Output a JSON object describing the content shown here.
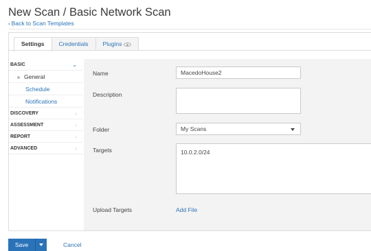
{
  "header": {
    "title": "New Scan / Basic Network Scan",
    "back_chevron": "‹",
    "back_link": "Back to Scan Templates"
  },
  "tabs": [
    {
      "label": "Settings",
      "active": true
    },
    {
      "label": "Credentials",
      "active": false
    },
    {
      "label": "Plugins",
      "active": false,
      "icon": "eye-icon"
    }
  ],
  "sidebar": {
    "basic": {
      "label": "BASIC",
      "expanded": true,
      "arrow": "⌄"
    },
    "basic_items": [
      {
        "label": "General",
        "active": true
      },
      {
        "label": "Schedule",
        "active": false
      },
      {
        "label": "Notifications",
        "active": false
      }
    ],
    "sections": [
      {
        "label": "DISCOVERY",
        "arrow": "›"
      },
      {
        "label": "ASSESSMENT",
        "arrow": "›"
      },
      {
        "label": "REPORT",
        "arrow": "›"
      },
      {
        "label": "ADVANCED",
        "arrow": "›"
      }
    ]
  },
  "form": {
    "name_label": "Name",
    "name_value": "MacedoHouse2",
    "description_label": "Description",
    "description_value": "",
    "folder_label": "Folder",
    "folder_value": "My Scans",
    "targets_label": "Targets",
    "targets_value": "10.0.2.0/24",
    "upload_label": "Upload Targets",
    "add_file_label": "Add File"
  },
  "footer": {
    "save_label": "Save",
    "cancel_label": "Cancel"
  },
  "colors": {
    "accent": "#2a73b8",
    "content_bg": "#f3f3f3"
  }
}
